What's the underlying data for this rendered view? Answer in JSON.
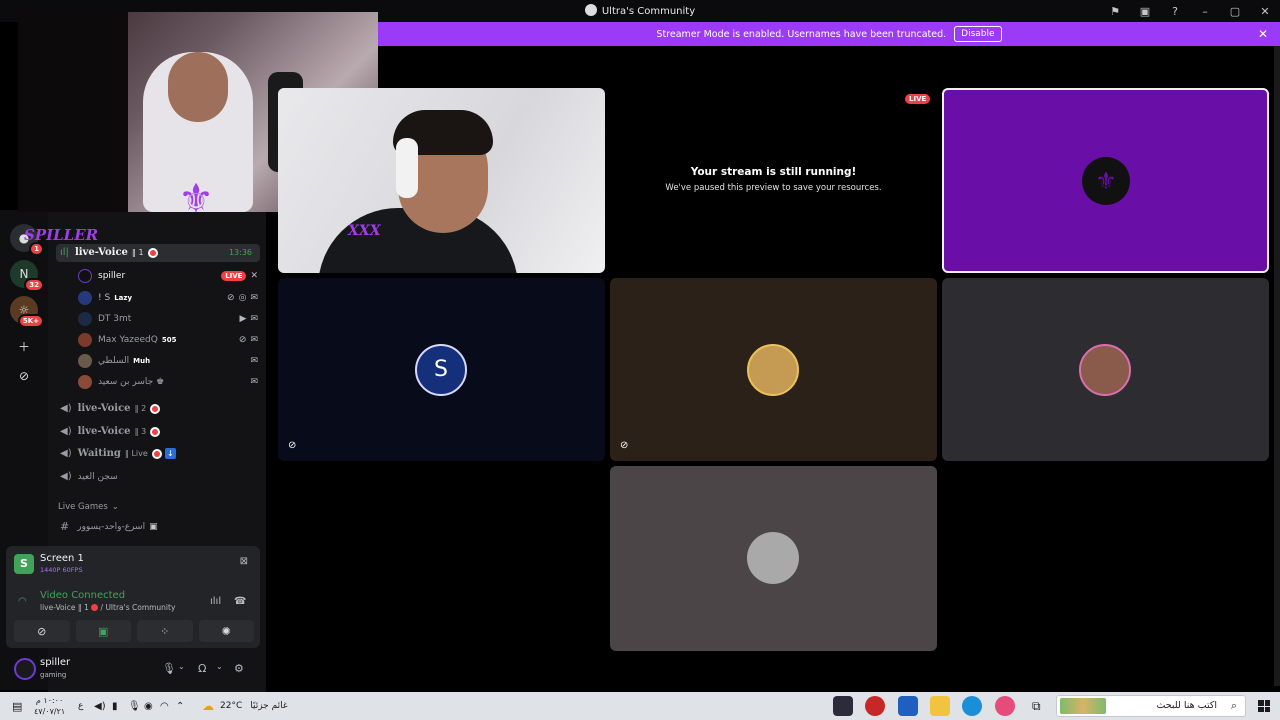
{
  "window": {
    "title": "Ultra's Community"
  },
  "banner": {
    "text": "Streamer Mode is enabled. Usernames have been truncated.",
    "disable_label": "Disable"
  },
  "rail": {
    "badges": [
      "1",
      "32",
      "5K+"
    ],
    "add_icon": "plus-icon",
    "discover_icon": "compass-icon"
  },
  "overlay": {
    "name_text": "SPILLER"
  },
  "sidebar": {
    "active_channel": {
      "name": "live-Voice",
      "suffix": "‖ 1",
      "timer": "13:36"
    },
    "members": [
      {
        "name": "spiller",
        "live": "LIVE"
      },
      {
        "name": "! S",
        "tag": "Lazy"
      },
      {
        "name": "DT 3mt"
      },
      {
        "name": "Max YazeedQ",
        "tag": "505"
      },
      {
        "name": "السلطي",
        "tag": "Muh"
      },
      {
        "name": "جاسر بن سعيد ♚"
      }
    ],
    "channels": [
      {
        "name": "live-Voice",
        "suffix": "‖ 2"
      },
      {
        "name": "live-Voice",
        "suffix": "‖ 3"
      },
      {
        "name": "Waiting",
        "suffix": "‖ Live"
      },
      {
        "name": "سجن العيد"
      }
    ],
    "category": "Live Games",
    "text_channel": "اسرع-واحد-يسوور"
  },
  "screen_panel": {
    "title": "Screen 1",
    "quality": "1440P 60FPS",
    "status": "Video Connected",
    "location": "live-Voice ‖ 1",
    "server": "/ Ultra's Community"
  },
  "user": {
    "name": "spiller",
    "status": "gaming"
  },
  "stage": {
    "paused_title": "Your stream is still running!",
    "paused_sub": "We've paused this preview to save your resources.",
    "live_label": "LIVE",
    "cam_watermark": "XXX"
  },
  "taskbar": {
    "time": "١٠:٠٠ م",
    "date": "٤٧/٠٧/٢١",
    "lang": "ع",
    "weather_temp": "22°C",
    "weather_text": "غائم جزئيًا",
    "search_placeholder": "اكتب هنا للبحث"
  },
  "colors": {
    "accent": "#9b3bf7",
    "live": "#f23f43",
    "connected": "#43a25a",
    "brand_purple": "#a23ee8"
  }
}
